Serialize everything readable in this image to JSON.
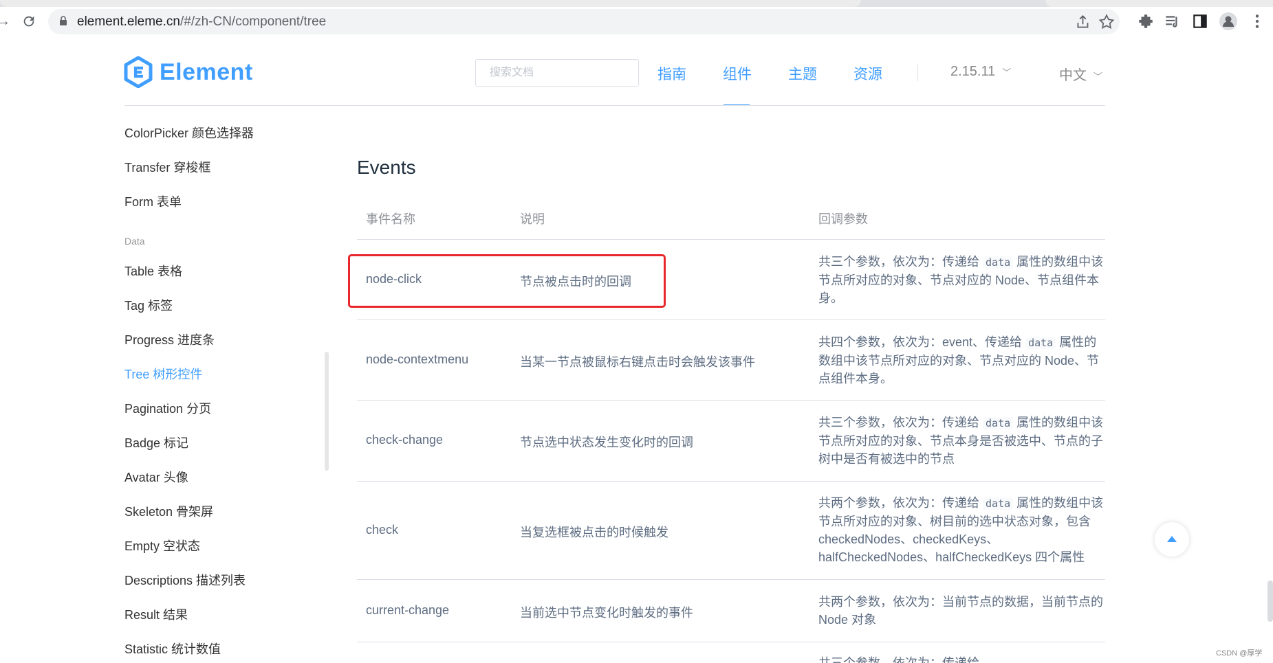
{
  "browser": {
    "url_host": "element.eleme.cn",
    "url_path": "/#/zh-CN/component/tree"
  },
  "site": {
    "logo_text": "Element",
    "search_placeholder": "搜索文档",
    "nav": [
      "指南",
      "组件",
      "主题",
      "资源"
    ],
    "active_nav": "组件",
    "version": "2.15.11",
    "language": "中文"
  },
  "sidebar": {
    "items_top": [
      "ColorPicker 颜色选择器",
      "Transfer 穿梭框",
      "Form 表单"
    ],
    "group_label": "Data",
    "items_data": [
      "Table 表格",
      "Tag 标签",
      "Progress 进度条",
      "Tree 树形控件",
      "Pagination 分页",
      "Badge 标记",
      "Avatar 头像",
      "Skeleton 骨架屏",
      "Empty 空状态",
      "Descriptions 描述列表",
      "Result 结果",
      "Statistic 统计数值"
    ],
    "active_item": "Tree 树形控件"
  },
  "events": {
    "title": "Events",
    "headers": [
      "事件名称",
      "说明",
      "回调参数"
    ],
    "rows": [
      {
        "name": "node-click",
        "desc": "节点被点击时的回调",
        "params_pre": "共三个参数，依次为：传递给",
        "params_code": "data",
        "params_post": "属性的数组中该节点所对应的对象、节点对应的 Node、节点组件本身。"
      },
      {
        "name": "node-contextmenu",
        "desc": "当某一节点被鼠标右键点击时会触发该事件",
        "params_pre": "共四个参数，依次为：event、传递给",
        "params_code": "data",
        "params_post": "属性的数组中该节点所对应的对象、节点对应的 Node、节点组件本身。"
      },
      {
        "name": "check-change",
        "desc": "节点选中状态发生变化时的回调",
        "params_pre": "共三个参数，依次为：传递给",
        "params_code": "data",
        "params_post": "属性的数组中该节点所对应的对象、节点本身是否被选中、节点的子树中是否有被选中的节点"
      },
      {
        "name": "check",
        "desc": "当复选框被点击的时候触发",
        "params_pre": "共两个参数，依次为：传递给",
        "params_code": "data",
        "params_post": "属性的数组中该节点所对应的对象、树目前的选中状态对象，包含 checkedNodes、checkedKeys、halfCheckedNodes、halfCheckedKeys 四个属性"
      },
      {
        "name": "current-change",
        "desc": "当前选中节点变化时触发的事件",
        "params_pre": "共两个参数，依次为：当前节点的数据，当前节点的 Node 对象",
        "params_code": "",
        "params_post": ""
      }
    ],
    "partial_row_text": "共三个参数，依次为：传递给"
  },
  "watermark": "CSDN @厚学",
  "colors": {
    "accent": "#409eff",
    "highlight": "#e8262b"
  }
}
